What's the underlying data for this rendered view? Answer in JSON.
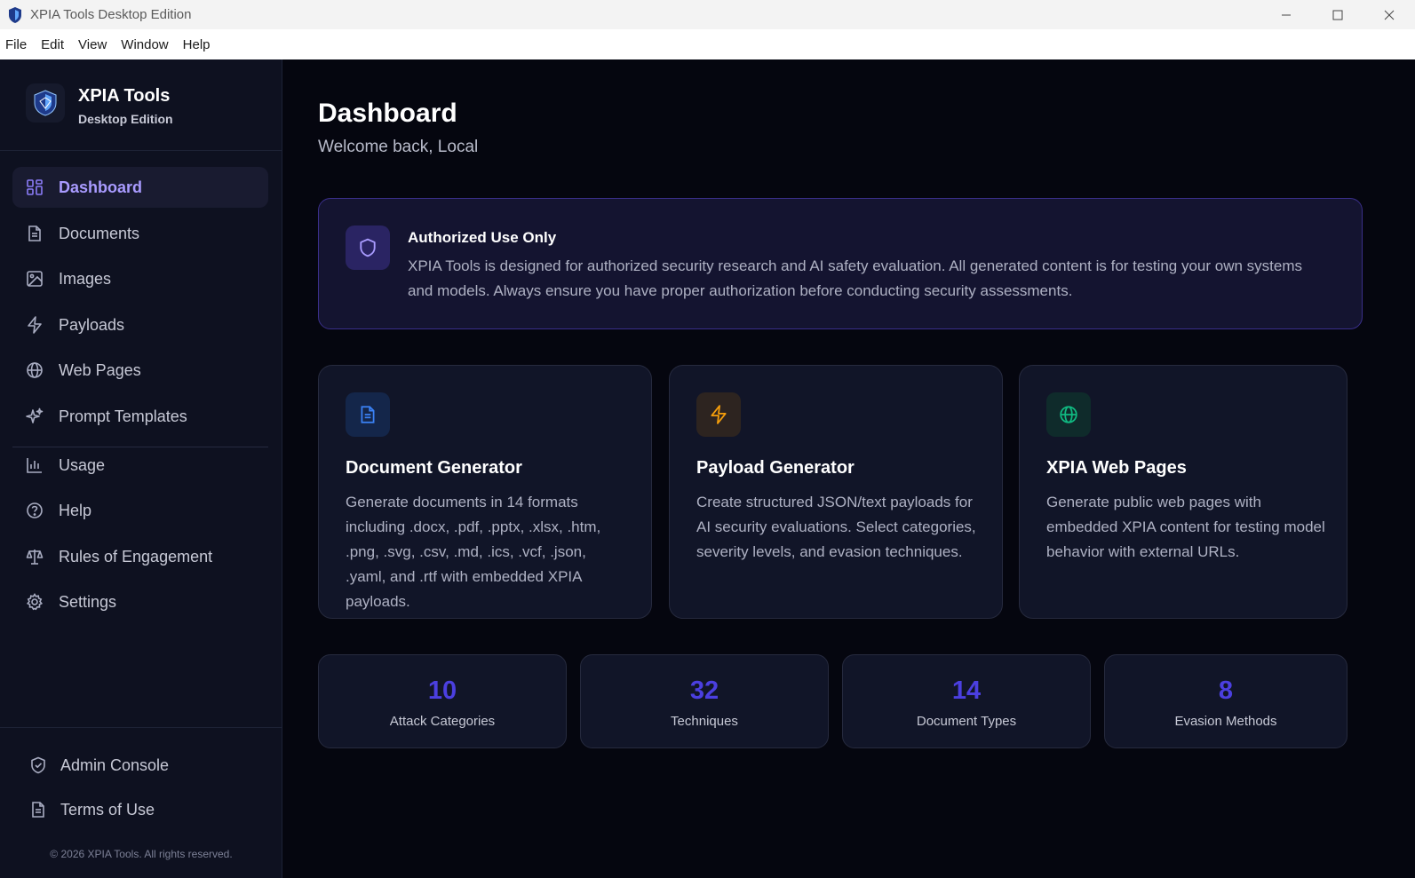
{
  "window": {
    "title": "XPIA Tools Desktop Edition",
    "controls": [
      "minimize-icon",
      "maximize-icon",
      "close-icon"
    ]
  },
  "menubar": {
    "items": [
      "File",
      "Edit",
      "View",
      "Window",
      "Help"
    ]
  },
  "sidebar": {
    "brand_name": "XPIA Tools",
    "brand_sub": "Desktop Edition",
    "items": [
      {
        "label": "Dashboard",
        "icon": "dashboard-grid-icon",
        "active": true
      },
      {
        "label": "Documents",
        "icon": "document-icon"
      },
      {
        "label": "Images",
        "icon": "image-icon"
      },
      {
        "label": "Payloads",
        "icon": "lightning-icon"
      },
      {
        "label": "Web Pages",
        "icon": "globe-icon"
      },
      {
        "label": "Prompt Templates",
        "icon": "sparkles-icon"
      },
      {
        "label": "Usage",
        "icon": "bar-chart-icon"
      },
      {
        "label": "Help",
        "icon": "help-circle-icon"
      },
      {
        "label": "Rules of Engagement",
        "icon": "scale-icon"
      },
      {
        "label": "Settings",
        "icon": "gear-icon"
      }
    ],
    "bottom_items": [
      {
        "label": "Admin Console",
        "icon": "shield-check-icon"
      },
      {
        "label": "Terms of Use",
        "icon": "document-icon"
      }
    ],
    "copyright": "© 2026 XPIA Tools. All rights reserved."
  },
  "main": {
    "title": "Dashboard",
    "subtitle": "Welcome back, Local",
    "notice": {
      "title": "Authorized Use Only",
      "text": "XPIA Tools is designed for authorized security research and AI safety evaluation. All generated content is for testing your own systems and models. Always ensure you have proper authorization before conducting security assessments."
    },
    "cards": [
      {
        "title": "Document Generator",
        "text": "Generate documents in 14 formats including .docx, .pdf, .pptx, .xlsx, .htm, .png, .svg, .csv, .md, .ics, .vcf, .json, .yaml, and .rtf with embedded XPIA payloads.",
        "icon": "document-icon",
        "accent": "#3b82f6"
      },
      {
        "title": "Payload Generator",
        "text": "Create structured JSON/text payloads for AI security evaluations. Select categories, severity levels, and evasion techniques.",
        "icon": "lightning-icon",
        "accent": "#f59e0b"
      },
      {
        "title": "XPIA Web Pages",
        "text": "Generate public web pages with embedded XPIA content for testing model behavior with external URLs.",
        "icon": "globe-icon",
        "accent": "#10b981"
      }
    ],
    "stats": [
      {
        "value": "10",
        "label": "Attack Categories"
      },
      {
        "value": "32",
        "label": "Techniques"
      },
      {
        "value": "14",
        "label": "Document Types"
      },
      {
        "value": "8",
        "label": "Evasion Methods"
      }
    ]
  },
  "colors": {
    "accent": "#8b7cf8",
    "stat_value": "#4b3fe0",
    "background": "#05060f",
    "sidebar": "#0e1120"
  }
}
